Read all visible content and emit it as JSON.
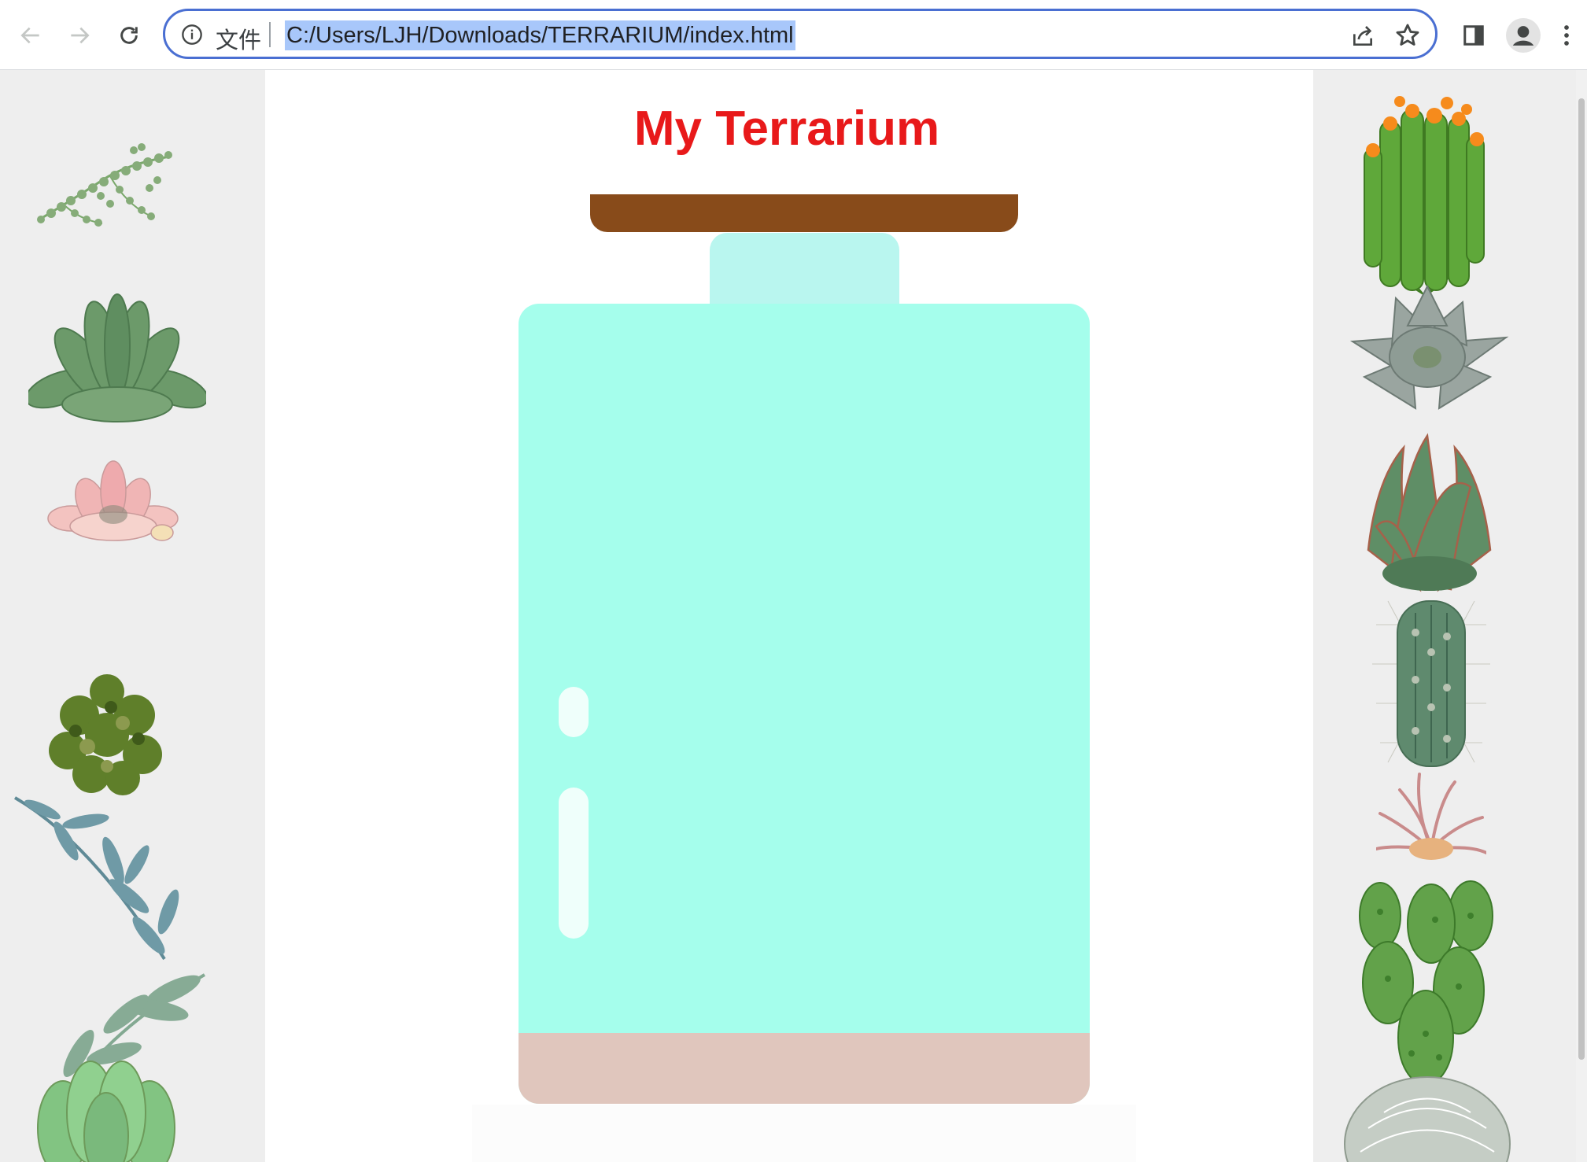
{
  "browser": {
    "info_chip": "文件",
    "url": "C:/Users/LJH/Downloads/TERRARIUM/index.html"
  },
  "page": {
    "title": "My Terrarium"
  },
  "colors": {
    "title": "#e8191a",
    "jar_lid": "#884b1a",
    "jar_top": "#b9f6ef",
    "jar_glass": "#a5feec",
    "jar_soil": "#e0c6bd",
    "side_panel": "#eeeeee"
  },
  "left_plants": [
    "string-of-pearls",
    "green-rosette-succulent",
    "pink-echeveria",
    "dark-green-leafy-plant",
    "eucalyptus-branch",
    "green-leaf-sprig",
    "jade-succulent"
  ],
  "right_plants": [
    "flowering-aloe",
    "grey-echeveria",
    "red-tipped-aloe",
    "spiny-cactus",
    "air-plant",
    "prickly-pear-cactus",
    "round-barrel-cactus"
  ]
}
